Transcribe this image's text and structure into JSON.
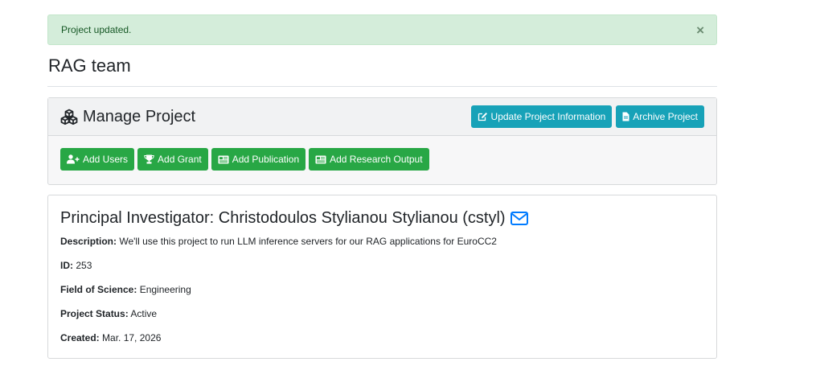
{
  "alert": {
    "message": "Project updated.",
    "close_label": "×"
  },
  "page": {
    "title": "RAG team"
  },
  "manage": {
    "title": "Manage Project",
    "header_buttons": {
      "update_label": "Update Project Information",
      "archive_label": "Archive Project"
    },
    "actions": {
      "add_users_label": "Add Users",
      "add_grant_label": "Add Grant",
      "add_publication_label": "Add Publication",
      "add_research_output_label": "Add Research Output"
    }
  },
  "pi": {
    "title": "Principal Investigator: Christodoulos Stylianou Stylianou (cstyl)",
    "fields": {
      "description_label": "Description:",
      "description_value": "We'll use this project to run LLM inference servers for our RAG applications for EuroCC2",
      "id_label": "ID:",
      "id_value": "253",
      "field_label": "Field of Science:",
      "field_value": "Engineering",
      "status_label": "Project Status:",
      "status_value": "Active",
      "created_label": "Created:",
      "created_value": "Mar. 17, 2026"
    }
  },
  "colors": {
    "success": "#28a745",
    "info": "#17a2b8",
    "alert_bg": "#d4edda",
    "link": "#007bff"
  },
  "icons": {
    "manage": "cubes-icon",
    "update": "edit-icon",
    "archive": "file-icon",
    "add_users": "user-plus-icon",
    "add_grant": "trophy-icon",
    "add_publication": "newspaper-icon",
    "add_research_output": "newspaper-icon",
    "email": "envelope-icon"
  }
}
